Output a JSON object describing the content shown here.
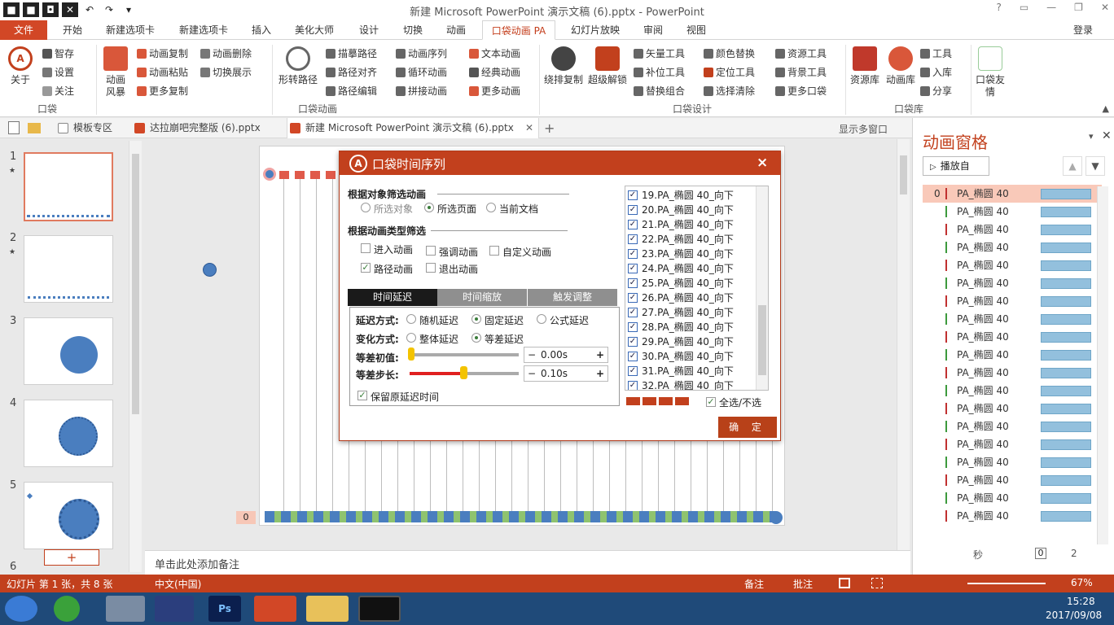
{
  "window": {
    "title": "新建 Microsoft PowerPoint 演示文稿 (6).pptx - PowerPoint",
    "help": "?",
    "login": "登录"
  },
  "tabs": [
    "文件",
    "开始",
    "新建选项卡",
    "新建选项卡",
    "插入",
    "美化大师",
    "设计",
    "切换",
    "动画",
    "口袋动画 PA",
    "幻灯片放映",
    "审阅",
    "视图"
  ],
  "ribbon": {
    "about": "关于",
    "ts": "智存",
    "settings": "设置",
    "follow": "关注",
    "fx_scene": "动画风暴",
    "copy_anim": "动画复制",
    "paste_anim": "动画粘贴",
    "more_copy": "更多复制",
    "del_anim": "动画删除",
    "switch_show": "切换展示",
    "shape_path": "形转路径",
    "trace_path": "描摹路径",
    "path_align": "路径对齐",
    "path_edit": "路径编辑",
    "seq": "动画序列",
    "loop": "循环动画",
    "split": "拼接动画",
    "text_anim": "文本动画",
    "classic": "经典动画",
    "more_anim": "更多动画",
    "orbit_copy": "绕排复制",
    "super_unlock": "超级解锁",
    "vector": "矢量工具",
    "patch": "补位工具",
    "replace_group": "替换组合",
    "color_replace": "颜色替换",
    "pos_tool": "定位工具",
    "select_clear": "选择清除",
    "res_tool": "资源工具",
    "bg_tool": "背景工具",
    "more_pocket": "更多口袋",
    "res_lib": "资源库",
    "anim_lib": "动画库",
    "tool": "工具",
    "warehouse": "入库",
    "share": "分享",
    "friends": "口袋友情",
    "g1": "口袋",
    "g2": "口袋动画",
    "g3": "口袋设计",
    "g4": "口袋库"
  },
  "doctabs": {
    "template": "模板专区",
    "file1": "达拉崩吧完整版 (6).pptx",
    "file2": "新建 Microsoft PowerPoint 演示文稿 (6).pptx",
    "multi": "显示多窗口"
  },
  "slides": [
    "1",
    "2",
    "3",
    "4",
    "5",
    "6"
  ],
  "add_slide": "+",
  "notes": "单击此处添加备注",
  "timeline_zero": "0",
  "anim_pane": {
    "title": "动画窗格",
    "play": "播放自",
    "item": "PA_椭圆 40",
    "first_index": "0",
    "seconds": "秒",
    "zoom_a": "0",
    "zoom_b": "2",
    "count": 19
  },
  "dialog": {
    "title": "口袋时间序列",
    "close": "×",
    "filter_obj": "根据对象筛选动画",
    "sel_obj": "所选对象",
    "sel_page": "所选页面",
    "cur_doc": "当前文档",
    "filter_type": "根据动画类型筛选",
    "enter": "进入动画",
    "emph": "强调动画",
    "custom": "自定义动画",
    "path": "路径动画",
    "exit": "退出动画",
    "tab1": "时间延迟",
    "tab2": "时间缩放",
    "tab3": "触发调整",
    "delay_mode": "延迟方式:",
    "random": "随机延迟",
    "fixed": "固定延迟",
    "formula": "公式延迟",
    "change_mode": "变化方式:",
    "whole": "整体延迟",
    "arith": "等差延迟",
    "init_label": "等差初值:",
    "init_val": "0.00s",
    "step_label": "等差步长:",
    "step_val": "0.10s",
    "keep": "保留原延迟时间",
    "select_all": "全选/不选",
    "ok": "确 定",
    "check": "✓",
    "minus": "−",
    "plus": "+",
    "items": [
      "19.PA_椭圆 40_向下",
      "20.PA_椭圆 40_向下",
      "21.PA_椭圆 40_向下",
      "22.PA_椭圆 40_向下",
      "23.PA_椭圆 40_向下",
      "24.PA_椭圆 40_向下",
      "25.PA_椭圆 40_向下",
      "26.PA_椭圆 40_向下",
      "27.PA_椭圆 40_向下",
      "28.PA_椭圆 40_向下",
      "29.PA_椭圆 40_向下",
      "30.PA_椭圆 40_向下",
      "31.PA_椭圆 40_向下",
      "32.PA_椭圆 40_向下"
    ]
  },
  "status": {
    "slide_info": "幻灯片 第 1 张，共 8 张",
    "lang": "中文(中国)",
    "notes": "备注",
    "comments": "批注",
    "zoom": "67%"
  },
  "clock": {
    "time": "15:28",
    "date": "2017/09/08"
  },
  "colors": {
    "accent": "#c2401d",
    "shape": "#4a7ebf"
  }
}
